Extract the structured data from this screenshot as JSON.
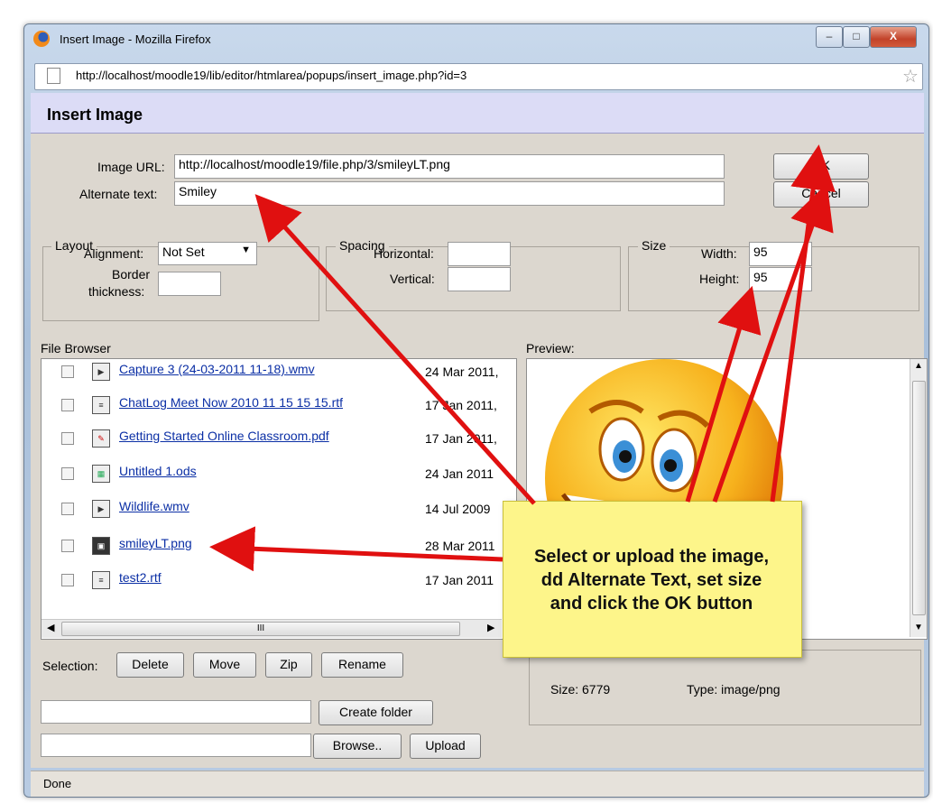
{
  "window": {
    "title": "Insert Image - Mozilla Firefox",
    "minimize": "–",
    "maximize": "□",
    "close": "X"
  },
  "urlbar": {
    "url": "http://localhost/moodle19/lib/editor/htmlarea/popups/insert_image.php?id=3"
  },
  "dialog": {
    "heading": "Insert Image"
  },
  "form": {
    "image_url_label": "Image URL:",
    "image_url_value": "http://localhost/moodle19/file.php/3/smileyLT.png",
    "alt_label": "Alternate text:",
    "alt_value": "Smiley",
    "ok": "OK",
    "cancel": "Cancel"
  },
  "layout": {
    "legend": "Layout",
    "alignment_label": "Alignment:",
    "alignment_value": "Not Set",
    "border_label_1": "Border",
    "border_label_2": "thickness:",
    "border_value": ""
  },
  "spacing": {
    "legend": "Spacing",
    "horizontal_label": "Horizontal:",
    "vertical_label": "Vertical:"
  },
  "size": {
    "legend": "Size",
    "width_label": "Width:",
    "width_value": "95",
    "height_label": "Height:",
    "height_value": "95"
  },
  "file_browser": {
    "label": "File Browser",
    "files": [
      {
        "name": "Capture 3 (24-03-2011 11-18).wmv",
        "date": "24 Mar 2011,",
        "icon": "video-icon"
      },
      {
        "name": "ChatLog Meet Now 2010 11 15 15 15.rtf",
        "date": "17 Jan 2011,",
        "icon": "document-icon"
      },
      {
        "name": "Getting Started Online Classroom.pdf",
        "date": "17 Jan 2011,",
        "icon": "pdf-icon"
      },
      {
        "name": "Untitled 1.ods",
        "date": "24 Jan 2011",
        "icon": "spreadsheet-icon"
      },
      {
        "name": "Wildlife.wmv",
        "date": "14 Jul 2009",
        "icon": "video-icon"
      },
      {
        "name": "smileyLT.png",
        "date": "28 Mar 2011",
        "icon": "image-icon"
      },
      {
        "name": "test2.rtf",
        "date": "17 Jan 2011",
        "icon": "document-icon"
      }
    ],
    "scroll_grip": "III"
  },
  "preview": {
    "label": "Preview:"
  },
  "selection": {
    "label": "Selection:",
    "delete": "Delete",
    "move": "Move",
    "zip": "Zip",
    "rename": "Rename"
  },
  "folder": {
    "create": "Create folder",
    "browse": "Browse..",
    "upload": "Upload"
  },
  "properties": {
    "size_label": "Size: 6779",
    "type_label": "Type: image/png"
  },
  "status": {
    "text": "Done"
  },
  "annotation": {
    "lines": [
      "Select or upload the image,",
      "dd Alternate Text, set size",
      "and click the OK button"
    ]
  },
  "colors": {
    "arrow": "#e01010",
    "callout": "#fdf58a",
    "header": "#dcdcf6",
    "dialog_bg": "#dcd7cf"
  }
}
